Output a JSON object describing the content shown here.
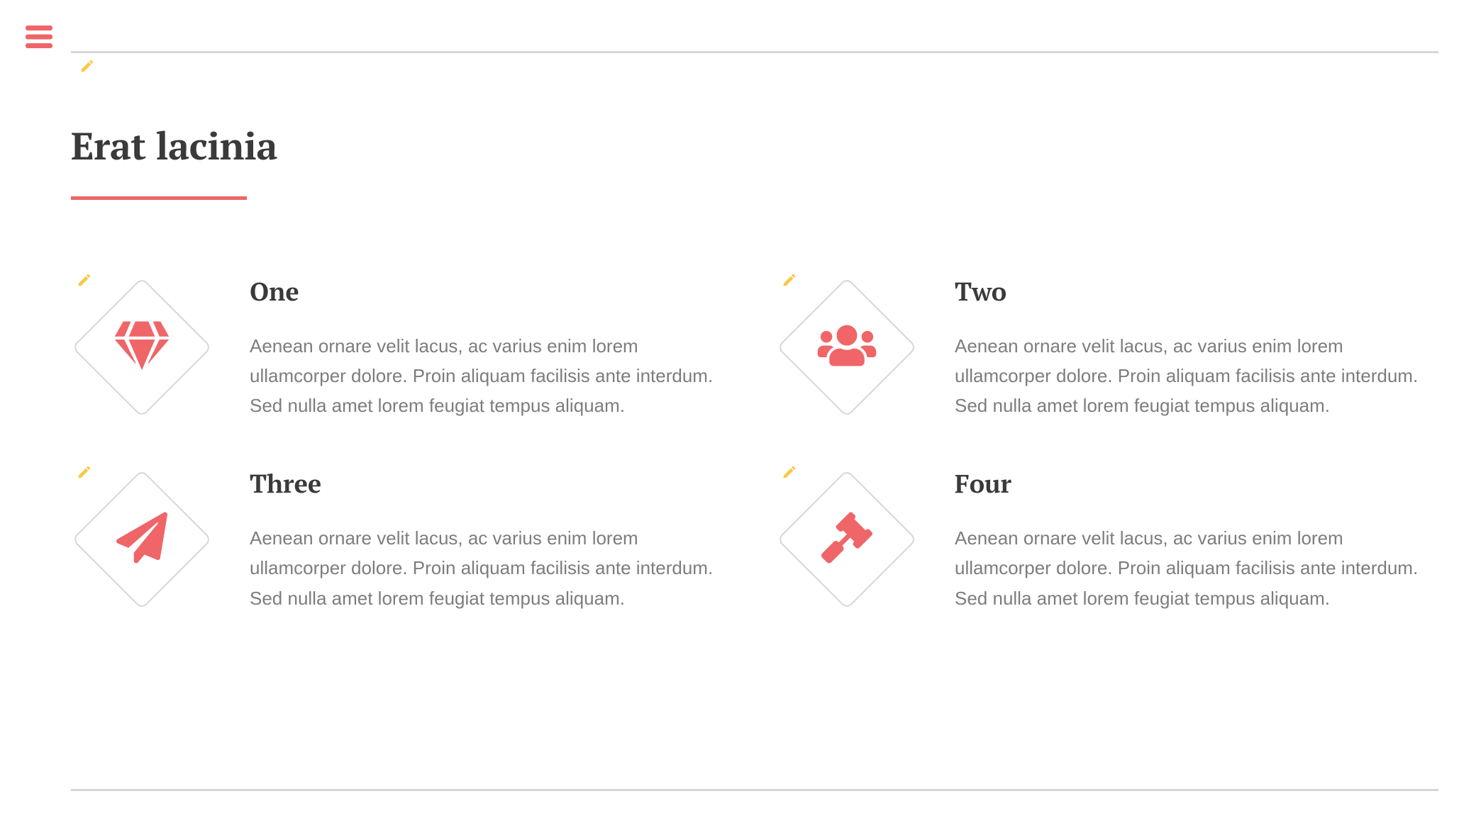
{
  "colors": {
    "accent": "#ef6568",
    "pencil": "#f7c948",
    "text_heading": "#3a3a3a",
    "text_body": "#7d7d7d",
    "line": "#d6d6d6"
  },
  "title": "Erat lacinia",
  "features": [
    {
      "icon": "gem-icon",
      "title": "One",
      "desc": "Aenean ornare velit lacus, ac varius enim lorem ullamcorper dolore. Proin aliquam facilisis ante interdum. Sed nulla amet lorem feugiat tempus aliquam."
    },
    {
      "icon": "users-icon",
      "title": "Two",
      "desc": "Aenean ornare velit lacus, ac varius enim lorem ullamcorper dolore. Proin aliquam facilisis ante interdum. Sed nulla amet lorem feugiat tempus aliquam."
    },
    {
      "icon": "paper-plane-icon",
      "title": "Three",
      "desc": "Aenean ornare velit lacus, ac varius enim lorem ullamcorper dolore. Proin aliquam facilisis ante interdum. Sed nulla amet lorem feugiat tempus aliquam."
    },
    {
      "icon": "gavel-icon",
      "title": "Four",
      "desc": "Aenean ornare velit lacus, ac varius enim lorem ullamcorper dolore. Proin aliquam facilisis ante interdum. Sed nulla amet lorem feugiat tempus aliquam."
    }
  ]
}
